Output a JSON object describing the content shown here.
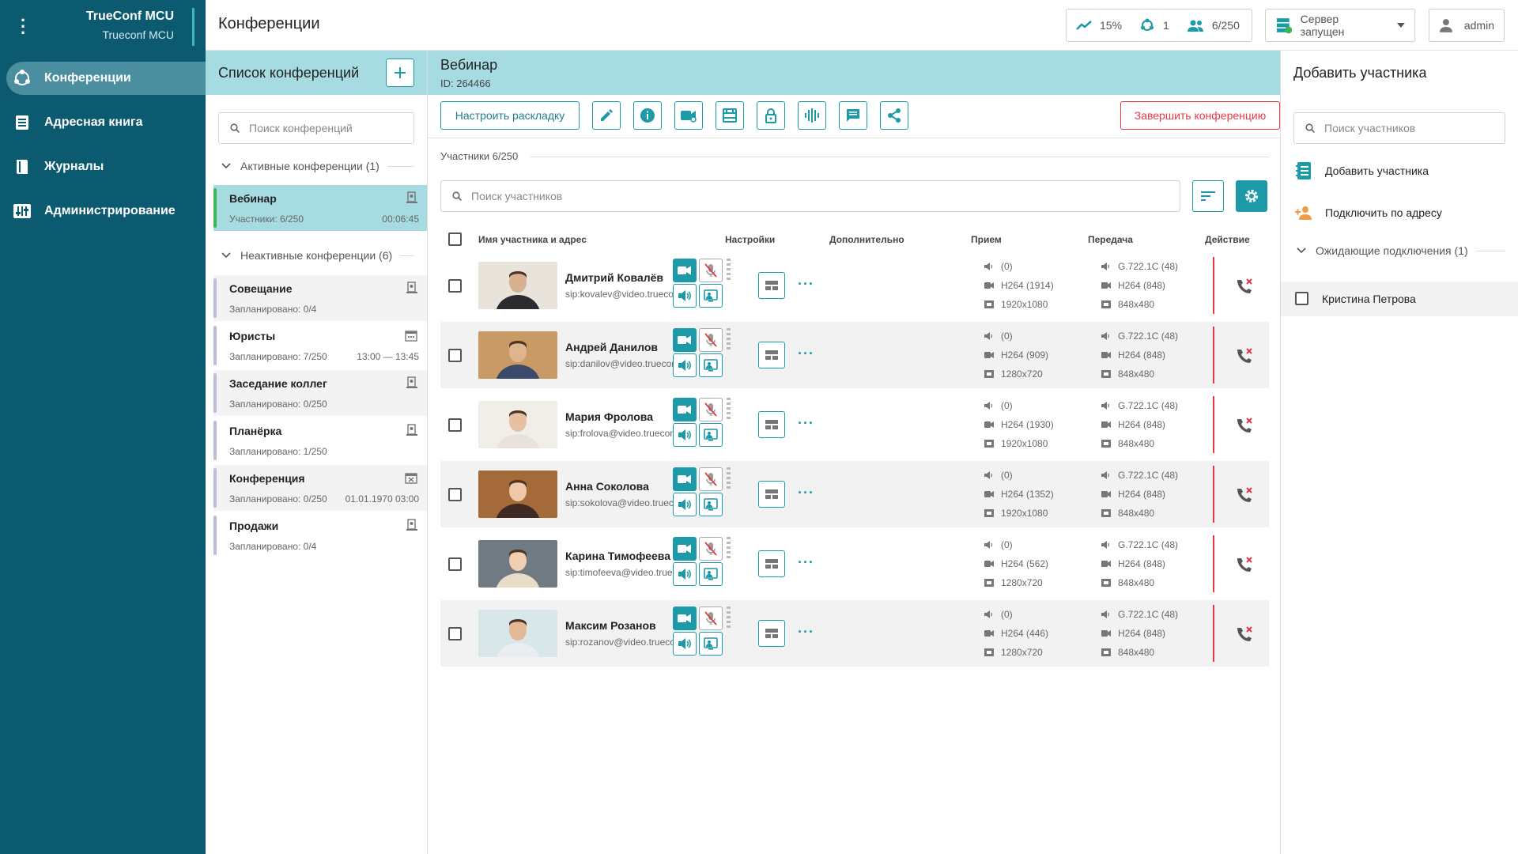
{
  "colors": {
    "sidebar": "#0b5a70",
    "accent": "#1d9aa8",
    "header": "#a6dce1",
    "danger": "#e53945",
    "active_bar": "#3cb552"
  },
  "brand": {
    "title": "TrueConf MCU",
    "subtitle": "Trueconf MCU"
  },
  "nav": [
    {
      "label": "Конференции",
      "icon": "conferences-icon"
    },
    {
      "label": "Адресная книга",
      "icon": "address-book-icon"
    },
    {
      "label": "Журналы",
      "icon": "logs-icon"
    },
    {
      "label": "Администрирование",
      "icon": "admin-icon"
    }
  ],
  "topbar": {
    "title": "Конференции",
    "load": "15%",
    "conferences": "1",
    "participants": "6/250",
    "server_status": "Сервер запущен",
    "user": "admin"
  },
  "conf_list": {
    "title": "Список конференций",
    "search_placeholder": "Поиск конференций",
    "active_group": "Активные конференции (1)",
    "inactive_group": "Неактивные конференции (6)",
    "active": [
      {
        "name": "Вебинар",
        "sub": "Участники: 6/250",
        "time": "00:06:45"
      }
    ],
    "inactive": [
      {
        "name": "Совещание",
        "sub": "Запланировано: 0/4",
        "time": ""
      },
      {
        "name": "Юристы",
        "sub": "Запланировано: 7/250",
        "time": "13:00 — 13:45"
      },
      {
        "name": "Заседание коллег",
        "sub": "Запланировано: 0/250",
        "time": ""
      },
      {
        "name": "Планёрка",
        "sub": "Запланировано: 1/250",
        "time": ""
      },
      {
        "name": "Конференция",
        "sub": "Запланировано: 0/250",
        "time": "01.01.1970 03:00"
      },
      {
        "name": "Продажи",
        "sub": "Запланировано: 0/4",
        "time": ""
      }
    ]
  },
  "conference": {
    "name": "Вебинар",
    "id": "ID: 264466",
    "layout_button": "Настроить раскладку",
    "end_button": "Завершить конференцию",
    "participants_title": "Участники 6/250",
    "search_placeholder": "Поиск участников",
    "columns": {
      "name": "Имя участника и адрес",
      "settings": "Настройки",
      "extra": "Дополнительно",
      "receive": "Прием",
      "send": "Передача",
      "action": "Действие"
    },
    "participants": [
      {
        "name": "Дмитрий Ковалёв",
        "address": "sip:kovalev@video.trueconf...",
        "rx_audio": "(0)",
        "rx_video": "H264 (1914)",
        "rx_res": "1920x1080",
        "tx_audio": "G.722.1C (48)",
        "tx_video": "H264 (848)",
        "tx_res": "848x480"
      },
      {
        "name": "Андрей Данилов",
        "address": "sip:danilov@video.trueconf...",
        "rx_audio": "(0)",
        "rx_video": "H264 (909)",
        "rx_res": "1280x720",
        "tx_audio": "G.722.1C (48)",
        "tx_video": "H264 (848)",
        "tx_res": "848x480"
      },
      {
        "name": "Мария Фролова",
        "address": "sip:frolova@video.trueconf...",
        "rx_audio": "(0)",
        "rx_video": "H264 (1930)",
        "rx_res": "1920x1080",
        "tx_audio": "G.722.1C (48)",
        "tx_video": "H264 (848)",
        "tx_res": "848x480"
      },
      {
        "name": "Анна Соколова",
        "address": "sip:sokolova@video.trueco...",
        "rx_audio": "(0)",
        "rx_video": "H264 (1352)",
        "rx_res": "1920x1080",
        "tx_audio": "G.722.1C (48)",
        "tx_video": "H264 (848)",
        "tx_res": "848x480"
      },
      {
        "name": "Карина Тимофеева",
        "address": "sip:timofeeva@video.truec...",
        "rx_audio": "(0)",
        "rx_video": "H264 (562)",
        "rx_res": "1280x720",
        "tx_audio": "G.722.1C (48)",
        "tx_video": "H264 (848)",
        "tx_res": "848x480"
      },
      {
        "name": "Максим Розанов",
        "address": "sip:rozanov@video.truecon...",
        "rx_audio": "(0)",
        "rx_video": "H264 (446)",
        "rx_res": "1280x720",
        "tx_audio": "G.722.1C (48)",
        "tx_video": "H264 (848)",
        "tx_res": "848x480"
      }
    ]
  },
  "add_panel": {
    "title": "Добавить участника",
    "search_placeholder": "Поиск участников",
    "add_participant": "Добавить участника",
    "connect_by_address": "Подключить по адресу",
    "waiting_group": "Ожидающие подключения (1)",
    "waiting": [
      {
        "name": "Кристина Петрова"
      }
    ]
  }
}
